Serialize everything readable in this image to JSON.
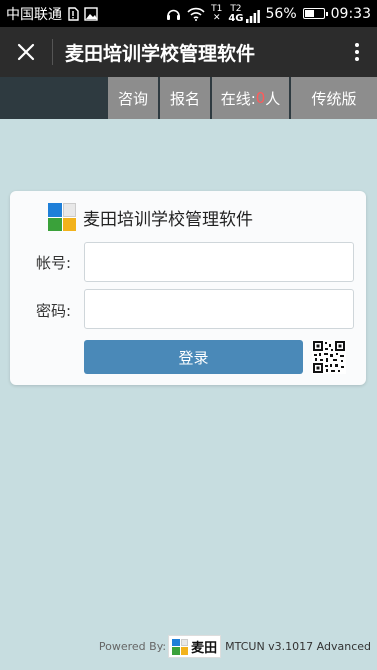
{
  "statusbar": {
    "carrier": "中国联通",
    "sim_label_top": "T1",
    "network_label": "4G",
    "sim_label_2": "T2",
    "battery_text": "56%",
    "battery_level": 0.56,
    "time": "09:33"
  },
  "appbar": {
    "title": "麦田培训学校管理软件"
  },
  "topnav": {
    "consult": "咨询",
    "signup": "报名",
    "online_prefix": "在线:",
    "online_count": "0",
    "online_suffix": "人",
    "classic": "传统版"
  },
  "login": {
    "title": "麦田培训学校管理软件",
    "account_label": "帐号:",
    "account_value": "",
    "password_label": "密码:",
    "password_value": "",
    "submit_label": "登录"
  },
  "footer": {
    "powered": "Powered By:",
    "brand": "麦田",
    "version": "MTCUN v3.1017 Advanced"
  },
  "colors": {
    "background": "#c7dde0",
    "nav_button": "#8d8d8d",
    "login_button": "#4a89b8",
    "online_count": "#ff5a5a"
  }
}
